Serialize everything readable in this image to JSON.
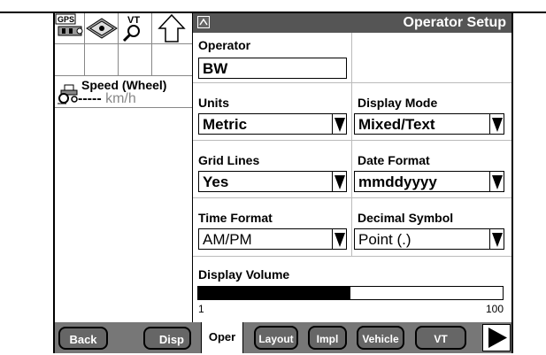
{
  "left": {
    "top_icons": [
      {
        "name": "gps-icon",
        "label": "GPS"
      },
      {
        "name": "manual-icon",
        "label": ""
      },
      {
        "name": "vt-icon",
        "label": "VT"
      },
      {
        "name": "up-arrow-icon",
        "label": ""
      }
    ],
    "speed": {
      "title": "Speed (Wheel)",
      "value": "-----",
      "unit": "km/h"
    }
  },
  "main": {
    "title": "Operator Setup",
    "operator": {
      "label": "Operator",
      "value": "BW"
    },
    "units": {
      "label": "Units",
      "value": "Metric"
    },
    "display_mode": {
      "label": "Display Mode",
      "value": "Mixed/Text"
    },
    "grid_lines": {
      "label": "Grid Lines",
      "value": "Yes"
    },
    "date_format": {
      "label": "Date Format",
      "value": "mmddyyyy"
    },
    "time_format": {
      "label": "Time Format",
      "value": "AM/PM"
    },
    "decimal_symbol": {
      "label": "Decimal Symbol",
      "value": "Point (.)"
    },
    "volume": {
      "label": "Display Volume",
      "min": "1",
      "max": "100",
      "level": 0.5
    }
  },
  "bottom": {
    "back": "Back",
    "disp": "Disp",
    "tabs": [
      {
        "label": "Oper",
        "active": true
      },
      {
        "label": "Layout"
      },
      {
        "label": "Impl"
      },
      {
        "label": "Vehicle"
      },
      {
        "label": "VT"
      }
    ]
  }
}
